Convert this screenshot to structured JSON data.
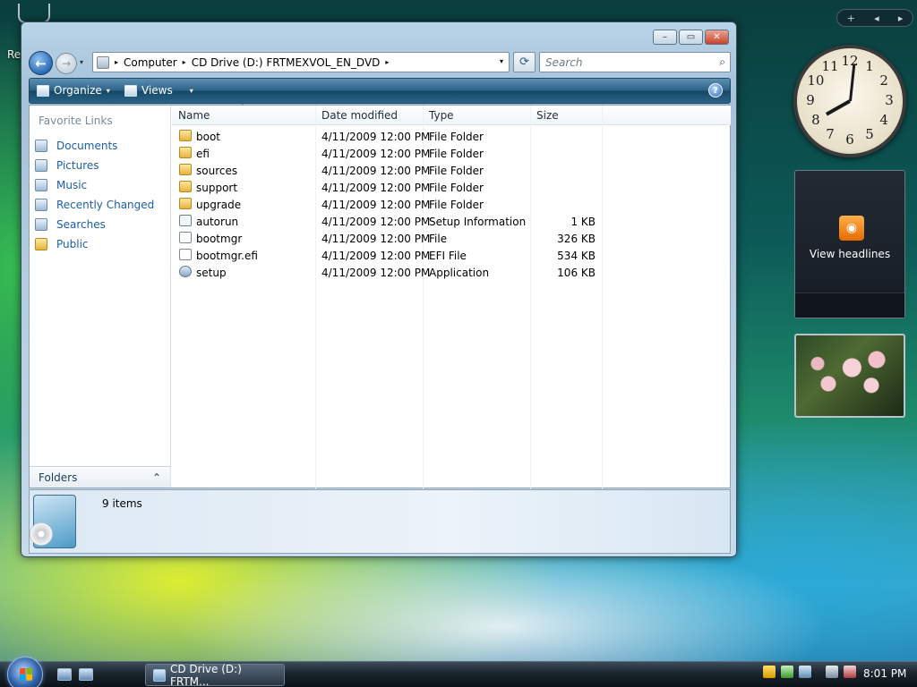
{
  "desktop": {
    "recycle_label": "Re"
  },
  "window": {
    "caption_buttons": {
      "minimize": "–",
      "maximize": "▭",
      "close": "✕"
    },
    "nav": {
      "back_icon": "←",
      "forward_icon": "→",
      "dropdown_icon": "▾"
    },
    "address": {
      "segments": [
        "Computer",
        "CD Drive (D:) FRTMEXVOL_EN_DVD"
      ],
      "separator": "▸",
      "dropdown_icon": "▾"
    },
    "refresh_icon": "⟳",
    "search": {
      "placeholder": "Search",
      "icon": "⌕"
    },
    "toolbar": {
      "organize": "Organize",
      "views": "Views",
      "dropdown_icon": "▾",
      "help": "?"
    },
    "nav_pane": {
      "title": "Favorite Links",
      "links": [
        {
          "label": "Documents",
          "icon": "documents-icon"
        },
        {
          "label": "Pictures",
          "icon": "pictures-icon"
        },
        {
          "label": "Music",
          "icon": "music-icon"
        },
        {
          "label": "Recently Changed",
          "icon": "recently-changed-icon"
        },
        {
          "label": "Searches",
          "icon": "searches-icon"
        },
        {
          "label": "Public",
          "icon": "public-folder-icon"
        }
      ],
      "folders_label": "Folders",
      "folders_chevron": "⌃"
    },
    "columns": [
      "Name",
      "Date modified",
      "Type",
      "Size"
    ],
    "sort_indicator": "⌃",
    "files": [
      {
        "name": "boot",
        "date": "4/11/2009 12:00 PM",
        "type": "File Folder",
        "size": "",
        "icon": "folder"
      },
      {
        "name": "efi",
        "date": "4/11/2009 12:00 PM",
        "type": "File Folder",
        "size": "",
        "icon": "folder"
      },
      {
        "name": "sources",
        "date": "4/11/2009 12:00 PM",
        "type": "File Folder",
        "size": "",
        "icon": "folder"
      },
      {
        "name": "support",
        "date": "4/11/2009 12:00 PM",
        "type": "File Folder",
        "size": "",
        "icon": "folder"
      },
      {
        "name": "upgrade",
        "date": "4/11/2009 12:00 PM",
        "type": "File Folder",
        "size": "",
        "icon": "folder"
      },
      {
        "name": "autorun",
        "date": "4/11/2009 12:00 PM",
        "type": "Setup Information",
        "size": "1 KB",
        "icon": "inf"
      },
      {
        "name": "bootmgr",
        "date": "4/11/2009 12:00 PM",
        "type": "File",
        "size": "326 KB",
        "icon": "file"
      },
      {
        "name": "bootmgr.efi",
        "date": "4/11/2009 12:00 PM",
        "type": "EFI File",
        "size": "534 KB",
        "icon": "file"
      },
      {
        "name": "setup",
        "date": "4/11/2009 12:00 PM",
        "type": "Application",
        "size": "106 KB",
        "icon": "setup"
      }
    ],
    "details": {
      "count": "9 items"
    }
  },
  "sidebar": {
    "controls": [
      "+",
      "◂",
      "▸"
    ],
    "clock": {
      "numerals": [
        "12",
        "1",
        "2",
        "3",
        "4",
        "5",
        "6",
        "7",
        "8",
        "9",
        "10",
        "11"
      ],
      "time": "8:01"
    },
    "headlines_label": "View headlines",
    "rss_icon": "◉"
  },
  "taskbar": {
    "task_label": "CD Drive (D:) FRTM...",
    "time": "8:01 PM"
  },
  "colors": {
    "link": "#1c5ea6",
    "toolbar": "#2d6389",
    "taskbar": "#1a242e"
  }
}
